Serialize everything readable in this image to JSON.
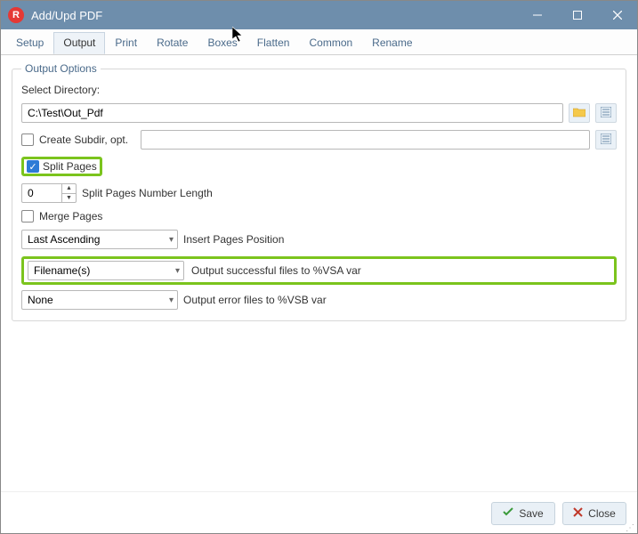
{
  "window": {
    "title": "Add/Upd PDF"
  },
  "tabs": {
    "items": [
      "Setup",
      "Output",
      "Print",
      "Rotate",
      "Boxes",
      "Flatten",
      "Common",
      "Rename"
    ],
    "active": "Output"
  },
  "options": {
    "legend": "Output Options",
    "select_directory_label": "Select Directory:",
    "directory_value": "C:\\Test\\Out_Pdf",
    "create_subdir_label": "Create Subdir, opt.",
    "create_subdir_value": "",
    "split_pages_label": "Split Pages",
    "split_pages_checked": true,
    "split_number_length_value": "0",
    "split_number_length_label": "Split Pages Number Length",
    "merge_pages_label": "Merge Pages",
    "insert_pages_select": "Last Ascending",
    "insert_pages_label": "Insert Pages Position",
    "vsa_select": "Filename(s)",
    "vsa_label": "Output successful files to %VSA var",
    "vsb_select": "None",
    "vsb_label": "Output error files to %VSB var"
  },
  "footer": {
    "save_label": "Save",
    "close_label": "Close"
  }
}
